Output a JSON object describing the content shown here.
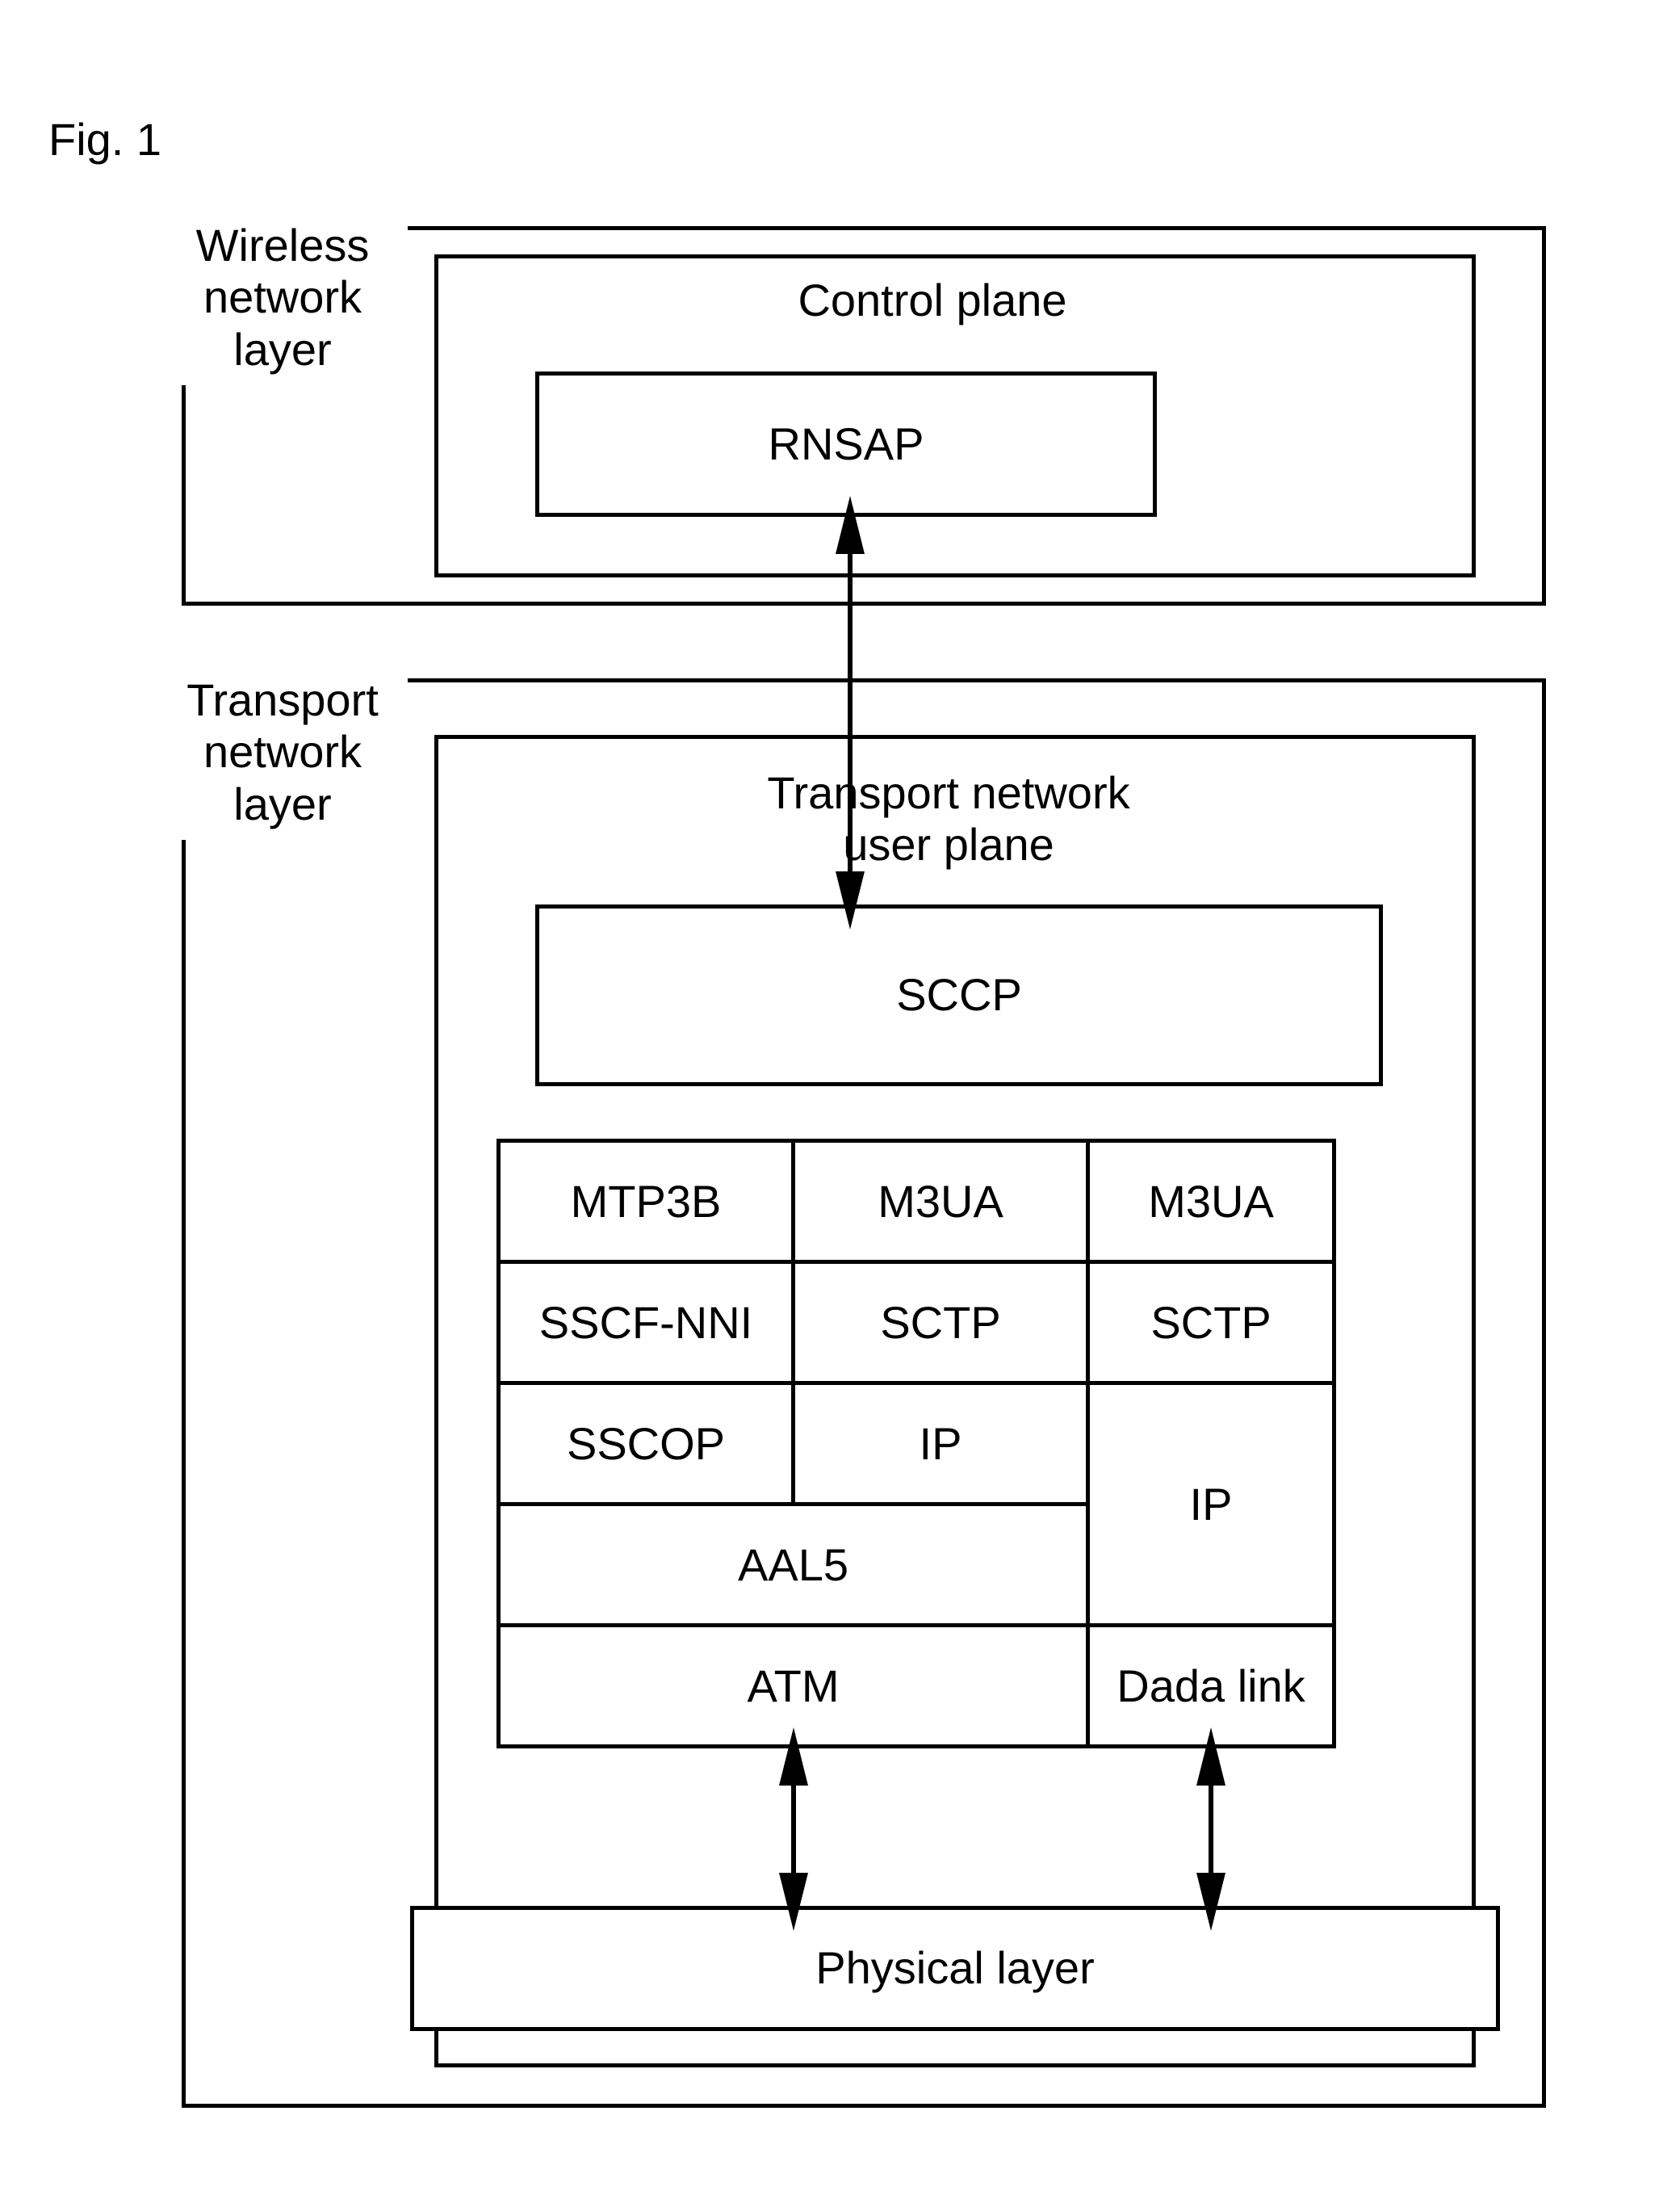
{
  "figure_label": "Fig. 1",
  "wireless_layer_label": "Wireless\nnetwork\nlayer",
  "transport_layer_label": "Transport\nnetwork\nlayer",
  "control_plane": "Control plane",
  "rnsap": "RNSAP",
  "transport_user_plane": "Transport network\nuser plane",
  "sccp": "SCCP",
  "stack": {
    "col1_r1": "MTP3B",
    "col2_r1": "M3UA",
    "col3_r1": "M3UA",
    "col1_r2": "SSCF-NNI",
    "col2_r2": "SCTP",
    "col3_r2": "SCTP",
    "col1_r3": "SSCOP",
    "col2_r3": "IP",
    "aal5": "AAL5",
    "ip_big": "IP",
    "atm": "ATM",
    "data_link": "Dada link"
  },
  "physical_layer": "Physical layer"
}
